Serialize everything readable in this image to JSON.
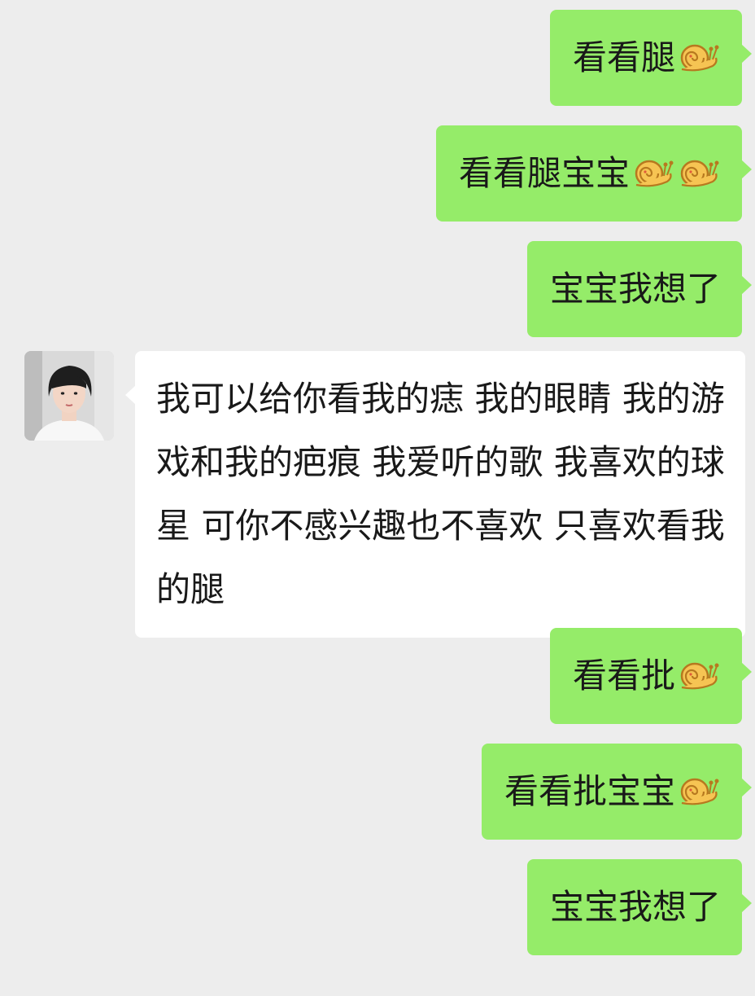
{
  "colors": {
    "background": "#ededed",
    "outgoing_bubble": "#95ec69",
    "incoming_bubble": "#ffffff",
    "text": "#191919"
  },
  "messages": [
    {
      "direction": "out",
      "text": "看看腿",
      "emoji": [
        "snail-emoji"
      ]
    },
    {
      "direction": "out",
      "text": "看看腿宝宝",
      "emoji": [
        "snail-emoji",
        "snail-emoji"
      ]
    },
    {
      "direction": "out",
      "text": "宝宝我想了",
      "emoji": []
    },
    {
      "direction": "in",
      "avatar": "person-avatar",
      "text": "我可以给你看我的痣 我的眼睛 我的游戏和我的疤痕 我爱听的歌 我喜欢的球星 可你不感兴趣也不喜欢 只喜欢看我的腿",
      "emoji": []
    },
    {
      "direction": "out",
      "text": "看看批",
      "emoji": [
        "snail-emoji"
      ]
    },
    {
      "direction": "out",
      "text": "看看批宝宝",
      "emoji": [
        "snail-emoji"
      ]
    },
    {
      "direction": "out",
      "text": "宝宝我想了",
      "emoji": []
    }
  ]
}
